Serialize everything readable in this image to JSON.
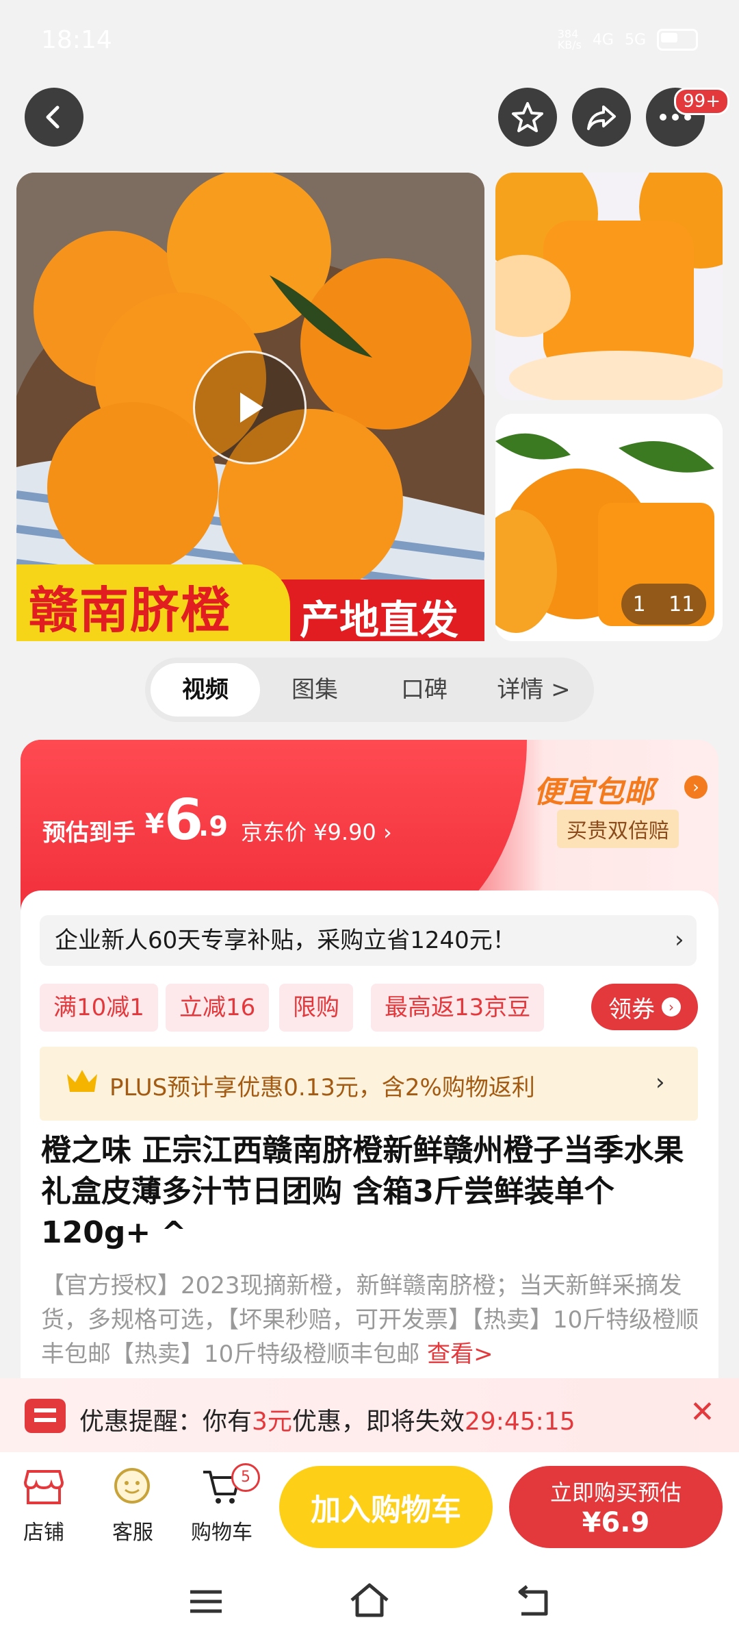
{
  "status_bar": {
    "time": "18:14",
    "net_speed": "384\nKB/s",
    "signal1": "4G",
    "signal2": "5G"
  },
  "top_nav": {
    "badge": "99+"
  },
  "gallery": {
    "banner_left": "赣南脐橙",
    "banner_right": "产地直发",
    "counter_current": "1",
    "counter_total": "11"
  },
  "tabs": [
    {
      "label": "视频"
    },
    {
      "label": "图集"
    },
    {
      "label": "口碑"
    },
    {
      "label": "详情 >"
    }
  ],
  "price": {
    "est_label": "预估到手",
    "yen": "¥",
    "int": "6",
    "dec": ".9",
    "jd_price": "京东价 ¥9.90 ›",
    "cheap_mail": "便宜包邮",
    "double_pay": "买贵双倍赔"
  },
  "new_user": {
    "text": "企业新人60天专享补贴，采购立省1240元！",
    "arrow": "›"
  },
  "promos": [
    "满10减1",
    "立减16",
    "限购",
    "最高返13京豆"
  ],
  "coupon": {
    "label": "领券"
  },
  "plus": {
    "text": "PLUS预计享优惠0.13元，含2%购物返利",
    "arrow": "›"
  },
  "product": {
    "title": "橙之味 正宗江西赣南脐橙新鲜赣州橙子当季水果礼盒皮薄多汁节日团购 含箱3斤尝鲜装单个120g+ ^",
    "desc": "【官方授权】2023现摘新橙，新鲜赣南脐橙；当天新鲜采摘发货，多规格可选，【坏果秒赔，可开发票】【热卖】10斤特级橙顺丰包邮【热卖】10斤特级橙顺丰包邮 ",
    "desc_more": "查看>"
  },
  "reminder": {
    "prefix": "优惠提醒：你有",
    "amount": "3元",
    "middle": "优惠，即将失效",
    "countdown": "29:45:15"
  },
  "action_bar": {
    "store": "店铺",
    "service": "客服",
    "cart": "购物车",
    "cart_count": "5",
    "add_cart": "加入购物车",
    "buy_line1": "立即购买预估",
    "buy_line2": "¥6.9"
  },
  "colors": {
    "accent_red": "#e4393c",
    "accent_yellow": "#fdd017",
    "plus_brown": "#a35a12"
  }
}
